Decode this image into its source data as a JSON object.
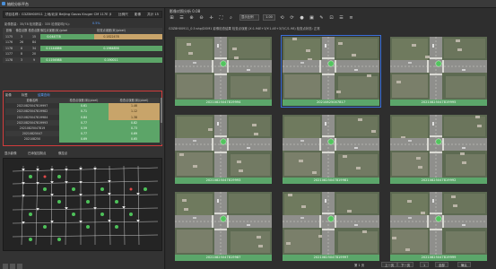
{
  "window": {
    "title": "抽检分析平台"
  },
  "info_bar": {
    "label": "项目名称：",
    "project": "G3Z8H00911 上地/北京 Beijing Gauss Kruger CM 117E (EPSG:4586)",
    "mid1": "比例尺",
    "mid2": "影像",
    "right": "共计 15"
  },
  "filter_row": {
    "text1": "影像数量：35/78 检测数量：335 检测影响(%)：",
    "value": "0.5%"
  },
  "point_table": {
    "headers": [
      "影像",
      "像控点数",
      "检查点数",
      "像控点误差(米)(pixel)",
      "",
      "检查点误差(米)(pixel)",
      ""
    ],
    "rows": [
      {
        "c": [
          "1175",
          "3",
          "15",
          "0.044778",
          "",
          "0.1822478",
          ""
        ]
      },
      {
        "c": [
          "1176",
          "26",
          "84",
          "",
          "",
          "",
          ""
        ]
      },
      {
        "c": [
          "1178",
          "8",
          "34",
          "0.1144886",
          "",
          "0.1964856",
          ""
        ]
      },
      {
        "c": [
          "1177",
          "8",
          "20",
          "",
          "",
          "",
          ""
        ]
      },
      {
        "c": [
          "1178",
          "3",
          "9",
          "0.1194988",
          "",
          "0.190011",
          ""
        ]
      }
    ]
  },
  "red_section": {
    "tabs": [
      "影像",
      "标签",
      "结果查询"
    ],
    "headers": [
      "影像名称",
      "检查点误差(米)(pixel)",
      "检查点误差(米)(pixel)"
    ],
    "rows": [
      {
        "name": "20210825047819997",
        "v1": "0.61",
        "v2": "1.46",
        "tan": true
      },
      {
        "name": "20210825047819982",
        "v1": "0.71",
        "v2": "1.12",
        "tan": true
      },
      {
        "name": "20210825047819984",
        "v1": "0.84",
        "v2": "1.38",
        "tan": true
      },
      {
        "name": "20210825047819993",
        "v1": "0.77",
        "v2": "0.82",
        "tan": false
      },
      {
        "name": "20210825047819",
        "v1": "0.59",
        "v2": "0.73",
        "tan": false
      },
      {
        "name": "20210825047",
        "v1": "0.77",
        "v2": "0.69",
        "tan": false
      },
      {
        "name": "202108250",
        "v1": "0.69",
        "v2": "0.65",
        "tan": false
      }
    ]
  },
  "map_tools": {
    "items": [
      "显示影像",
      "已添加控制点",
      "像控点"
    ]
  },
  "right_panel": {
    "header": "影像对照分析  0.08",
    "toolbar": {
      "items": [
        "⊞",
        "☰",
        "⊕",
        "⊖",
        "✛",
        "⛶",
        "⌕"
      ],
      "select_value": "显示比例",
      "zoom_value": "1.00",
      "more": [
        "⟲",
        "⟳",
        "●",
        "▣",
        "✎",
        "⊡",
        "☰",
        "≡"
      ]
    },
    "path": "G3Z8H00911_0.5:shp/DOM1 影像检查结果 检查点误差 (X:1.94E+3/Y:1.4E+3/7/C/1.98) 检查点状态: 正常",
    "images": [
      {
        "label": "20210825047819994",
        "selected": false
      },
      {
        "label": "20210825047817",
        "selected": true
      },
      {
        "label": "20210825047819995",
        "selected": false
      },
      {
        "label": "20210825047819993",
        "selected": false
      },
      {
        "label": "20210825047819981",
        "selected": false
      },
      {
        "label": "20210825047819992",
        "selected": false
      },
      {
        "label": "20210825047819987",
        "selected": false
      },
      {
        "label": "20210825047819997",
        "selected": false
      },
      {
        "label": "20210825047819999",
        "selected": false
      }
    ]
  },
  "bottom_bar": {
    "buttons": [
      "上一页",
      "下一页",
      "1",
      "全部",
      "确认"
    ],
    "status": "第 1 页"
  },
  "colors": {
    "accent_green": "#5ba66a",
    "tan": "#c8a46a",
    "select_blue": "#3a6fd8",
    "red_frame": "#d23c3c"
  }
}
